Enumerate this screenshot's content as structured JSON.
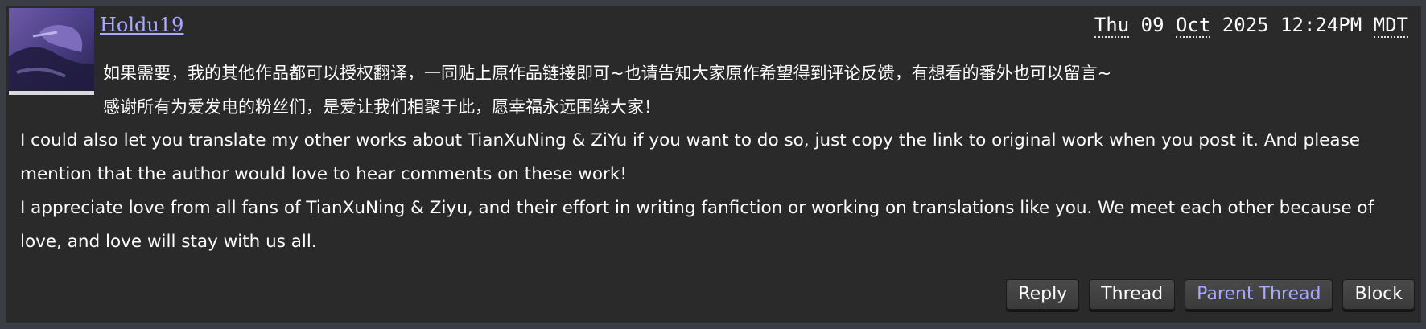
{
  "comment": {
    "author": "Holdu19",
    "datetime": {
      "weekday": "Thu",
      "day": "09",
      "month": "Oct",
      "year_time": "2025 12:24PM",
      "tz": "MDT"
    },
    "body_zh": [
      "如果需要，我的其他作品都可以授权翻译，一同贴上原作品链接即可~也请告知大家原作希望得到评论反馈，有想看的番外也可以留言~",
      "感谢所有为爱发电的粉丝们，是爱让我们相聚于此，愿幸福永远围绕大家！"
    ],
    "body_en": [
      "I could also let you translate my other works about TianXuNing & ZiYu if you want to do so, just copy the link to original work when you post it. And please mention that the author would love to hear comments on these work!",
      "I appreciate love from all fans of TianXuNing & Ziyu, and their effort in writing fanfiction or working on translations like you. We meet each other because of love, and love will stay with us all."
    ]
  },
  "actions": {
    "reply": "Reply",
    "thread": "Thread",
    "parent_thread": "Parent Thread",
    "block": "Block"
  },
  "colors": {
    "background": "#2a2a2a",
    "page": "#3a3d44",
    "link": "#a9a9ff",
    "text": "#ffffff"
  },
  "icons": {
    "avatar": "user-avatar-image"
  }
}
